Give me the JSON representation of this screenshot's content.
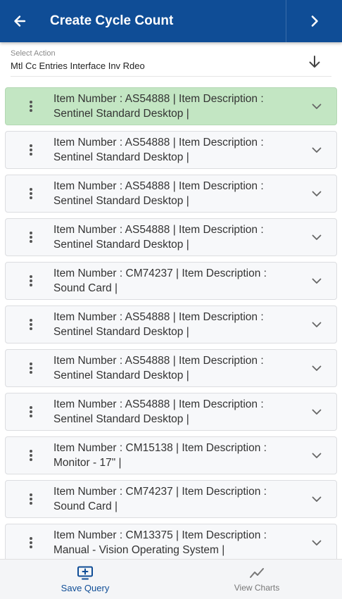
{
  "header": {
    "title": "Create Cycle Count",
    "back_icon": "arrow-left-icon",
    "next_icon": "chevron-right-icon",
    "background": "#0f4d96"
  },
  "action": {
    "label": "Select Action",
    "value": "Mtl Cc Entries Interface Inv Rdeo",
    "icon": "arrow-down-icon"
  },
  "items": [
    {
      "line1": "Item Number : AS54888 | Item Description :",
      "line2": "Sentinel Standard Desktop |",
      "selected": true
    },
    {
      "line1": "Item Number : AS54888 | Item Description :",
      "line2": "Sentinel Standard Desktop |",
      "selected": false
    },
    {
      "line1": "Item Number : AS54888 | Item Description :",
      "line2": "Sentinel Standard Desktop |",
      "selected": false
    },
    {
      "line1": "Item Number : AS54888 | Item Description :",
      "line2": "Sentinel Standard Desktop |",
      "selected": false
    },
    {
      "line1": "Item Number : CM74237 | Item Description :",
      "line2": "Sound Card |",
      "selected": false
    },
    {
      "line1": "Item Number : AS54888 | Item Description :",
      "line2": "Sentinel Standard Desktop |",
      "selected": false
    },
    {
      "line1": "Item Number : AS54888 | Item Description :",
      "line2": "Sentinel Standard Desktop |",
      "selected": false
    },
    {
      "line1": "Item Number : AS54888 | Item Description :",
      "line2": "Sentinel Standard Desktop |",
      "selected": false
    },
    {
      "line1": "Item Number : CM15138 | Item Description :",
      "line2": "Monitor - 17\" |",
      "selected": false
    },
    {
      "line1": "Item Number : CM74237 | Item Description :",
      "line2": "Sound Card |",
      "selected": false
    },
    {
      "line1": "Item Number : CM13375 | Item Description :",
      "line2": "Manual - Vision Operating System |",
      "selected": false
    }
  ],
  "footer": {
    "save_label": "Save Query",
    "save_icon": "monitor-plus-icon",
    "charts_label": "View Charts",
    "charts_icon": "line-chart-icon"
  },
  "colors": {
    "selected_row": "#c3e6c3",
    "row": "#f7f8fa",
    "accent": "#0f4d96"
  }
}
